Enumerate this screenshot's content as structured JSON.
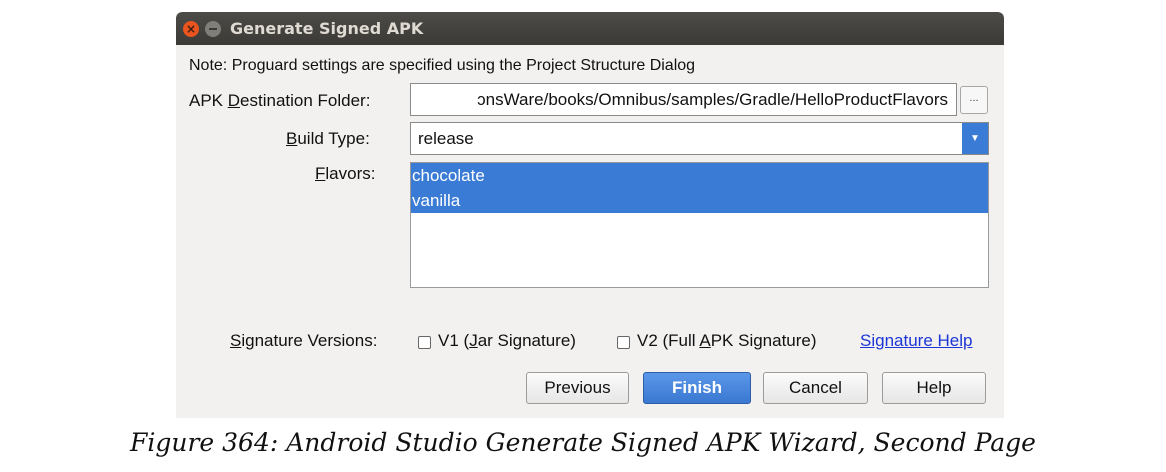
{
  "window": {
    "title": "Generate Signed APK"
  },
  "note": "Note: Proguard settings are specified using the Project Structure Dialog",
  "apk_destination": {
    "label_pre": "APK ",
    "label_mnemonic": "D",
    "label_post": "estination Folder:",
    "value": "ɔnsWare/books/Omnibus/samples/Gradle/HelloProductFlavors",
    "browse_label": "..."
  },
  "build_type": {
    "label_mnemonic": "B",
    "label_post": "uild Type:",
    "selected": "release"
  },
  "flavors": {
    "label_mnemonic": "F",
    "label_post": "lavors:",
    "items": [
      "chocolate",
      "vanilla"
    ]
  },
  "signature": {
    "label_mnemonic": "S",
    "label_post": "ignature Versions:",
    "v1_pre": "V1 (",
    "v1_mnemonic": "J",
    "v1_post": "ar Signature)",
    "v2_pre": "V2 (Full ",
    "v2_mnemonic": "A",
    "v2_post": "PK Signature)",
    "help_link": "Signature Help",
    "v1_checked": false,
    "v2_checked": false
  },
  "buttons": {
    "previous": "Previous",
    "finish": "Finish",
    "cancel": "Cancel",
    "help": "Help"
  },
  "caption": "Figure 364: Android Studio Generate Signed APK Wizard, Second Page",
  "colors": {
    "accent": "#3a7bd5",
    "titlebar": "#3b3a36",
    "close": "#e9541f",
    "link": "#1b35d6"
  }
}
